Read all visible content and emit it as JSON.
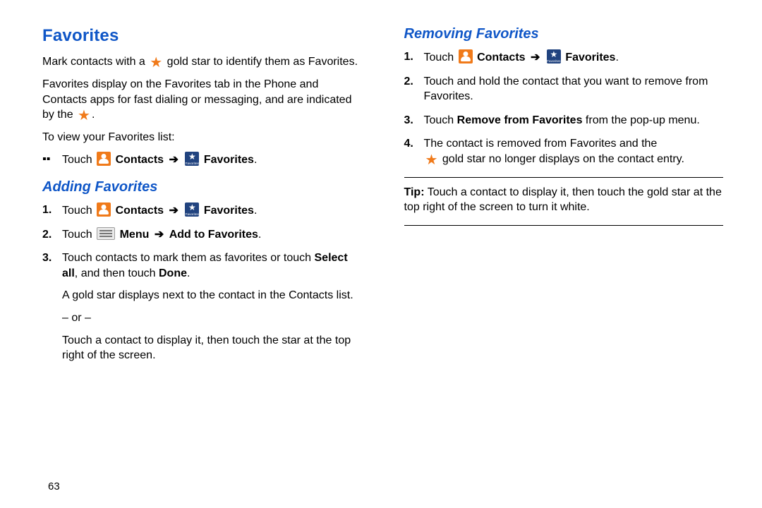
{
  "page_number": "63",
  "left": {
    "title": "Favorites",
    "p1a": "Mark contacts with a ",
    "p1b": " gold star to identify them as Favorites.",
    "p2": "Favorites display on the Favorites tab in the Phone and Contacts apps for fast dialing or messaging, and are indicated by the ",
    "p2end": ".",
    "p3": "To view your Favorites list:",
    "touch": "Touch ",
    "contacts": "Contacts",
    "arrow": "➔",
    "favorites": "Favorites",
    "dot": ".",
    "h2": "Adding Favorites",
    "s2a": "Touch ",
    "s2menu": "Menu",
    "s2b": "Add to Favorites",
    "s3a": "Touch contacts to mark them as favorites or touch ",
    "s3b": "Select all",
    "s3c": ", and then touch ",
    "s3d": "Done",
    "s3e": ".",
    "s3f": "A gold star displays next to the contact in the Contacts list.",
    "or": "– or –",
    "s3g": "Touch a contact to display it, then touch the star at the top right of the screen.",
    "favlabel": "Favorites"
  },
  "right": {
    "h2": "Removing Favorites",
    "touch": "Touch ",
    "contacts": "Contacts",
    "arrow": "➔",
    "favorites": "Favorites",
    "dot": ".",
    "s2": "Touch and hold the contact that you want to remove from Favorites.",
    "s3a": "Touch ",
    "s3b": "Remove from Favorites",
    "s3c": " from the pop-up menu.",
    "s4a": "The contact is removed from Favorites and the",
    "s4b": " gold star no longer displays on the contact entry.",
    "tip_label": "Tip:",
    "tip": " Touch a contact to display it, then touch the gold star at the top right of the screen to turn it white.",
    "favlabel": "Favorites"
  }
}
